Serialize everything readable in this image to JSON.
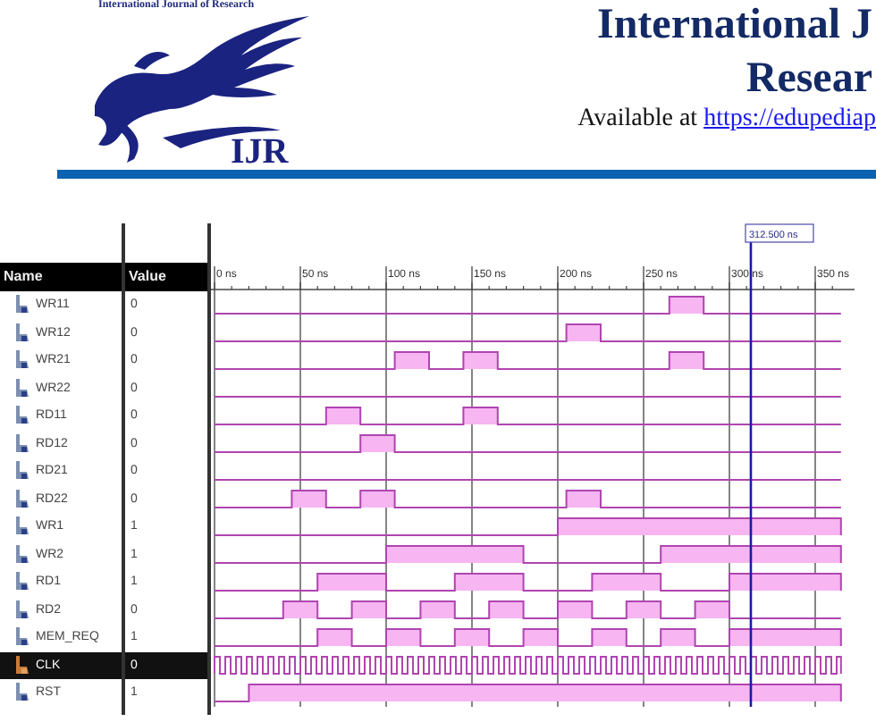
{
  "journal": {
    "masthead": "International Journal of Research",
    "logo_text": "IJR",
    "title_lines": [
      "International J",
      "Resear"
    ],
    "availability": "Available at ",
    "link": "https://edupediap"
  },
  "waveform_viewer": {
    "columns": [
      "Name",
      "Value"
    ],
    "cursor": "312.500 ns",
    "time_labels": [
      "0 ns",
      "50 ns",
      "100 ns",
      "150 ns",
      "200 ns",
      "250 ns",
      "300 ns",
      "350 ns"
    ],
    "signals": [
      {
        "name": "WR11",
        "value": "0",
        "kind": "wave",
        "selected": false
      },
      {
        "name": "WR12",
        "value": "0",
        "kind": "wave",
        "selected": false
      },
      {
        "name": "WR21",
        "value": "0",
        "kind": "wave",
        "selected": false
      },
      {
        "name": "WR22",
        "value": "0",
        "kind": "wave",
        "selected": false
      },
      {
        "name": "RD11",
        "value": "0",
        "kind": "wave",
        "selected": false
      },
      {
        "name": "RD12",
        "value": "0",
        "kind": "wave",
        "selected": false
      },
      {
        "name": "RD21",
        "value": "0",
        "kind": "wave",
        "selected": false
      },
      {
        "name": "RD22",
        "value": "0",
        "kind": "wave",
        "selected": false
      },
      {
        "name": "WR1",
        "value": "1",
        "kind": "wave",
        "selected": false
      },
      {
        "name": "WR2",
        "value": "1",
        "kind": "wave",
        "selected": false
      },
      {
        "name": "RD1",
        "value": "1",
        "kind": "wave",
        "selected": false
      },
      {
        "name": "RD2",
        "value": "0",
        "kind": "wave",
        "selected": false
      },
      {
        "name": "MEM_REQ",
        "value": "1",
        "kind": "wave",
        "selected": false
      },
      {
        "name": "CLK",
        "value": "0",
        "kind": "clock",
        "selected": true
      },
      {
        "name": "RST",
        "value": "1",
        "kind": "wave",
        "selected": false
      }
    ]
  }
}
